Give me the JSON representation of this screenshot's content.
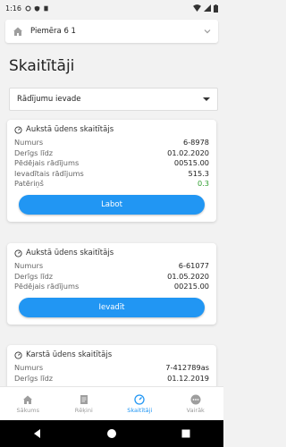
{
  "status_bar": {
    "time": "1:16"
  },
  "property_select": {
    "value": "Piemēra 6  1"
  },
  "page": {
    "title": "Skaitītāji"
  },
  "mode_select": {
    "value": "Rādījumu ievade"
  },
  "meters": [
    {
      "title": "Aukstā ūdens skaitītājs",
      "rows": [
        {
          "label": "Numurs",
          "value": "6-8978"
        },
        {
          "label": "Derīgs līdz",
          "value": "01.02.2020"
        },
        {
          "label": "Pēdējais rādījums",
          "value": "00515.00"
        },
        {
          "label": "Ievadītais rādījums",
          "value": "515.3"
        },
        {
          "label": "Patēriņš",
          "value": "0.3"
        }
      ],
      "button": "Labot"
    },
    {
      "title": "Aukstā ūdens skaitītājs",
      "rows": [
        {
          "label": "Numurs",
          "value": "6-61077"
        },
        {
          "label": "Derīgs līdz",
          "value": "01.05.2020"
        },
        {
          "label": "Pēdējais rādījums",
          "value": "00215.00"
        }
      ],
      "button": "Ievadīt"
    },
    {
      "title": "Karstā ūdens skaitītājs",
      "rows": [
        {
          "label": "Numurs",
          "value": "7-412789as"
        },
        {
          "label": "Derīgs līdz",
          "value": "01.12.2019"
        }
      ]
    }
  ],
  "bottom_nav": [
    {
      "label": "Sākums",
      "icon": "home-icon"
    },
    {
      "label": "Rēķini",
      "icon": "invoice-icon"
    },
    {
      "label": "Skaitītāji",
      "icon": "meter-icon"
    },
    {
      "label": "Vairāk",
      "icon": "more-icon"
    }
  ],
  "colors": {
    "accent": "#2196f3",
    "consumption": "#2e9e2e"
  }
}
